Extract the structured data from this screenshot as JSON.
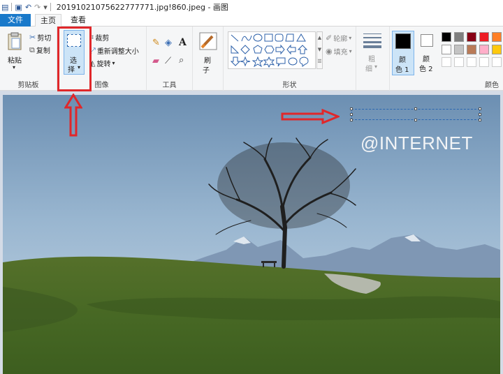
{
  "titlebar": {
    "title": "20191021075622777771.jpg!860.jpeg - 画图",
    "save_icon": "save-icon",
    "undo_icon": "undo-icon",
    "redo_icon": "redo-icon"
  },
  "tabs": {
    "file": "文件",
    "home": "主页",
    "view": "查看"
  },
  "clipboard": {
    "paste": "粘贴",
    "cut": "剪切",
    "copy": "复制",
    "label": "剪贴板"
  },
  "image": {
    "select_1": "选",
    "select_2": "择",
    "crop": "裁剪",
    "resize": "重新调整大小",
    "rotate": "旋转",
    "label": "图像"
  },
  "tools": {
    "label": "工具"
  },
  "brush": {
    "label_1": "刷",
    "label_2": "子"
  },
  "shapes": {
    "outline": "轮廓",
    "fill": "填充",
    "label": "形状"
  },
  "size": {
    "label_1": "粗",
    "label_2": "细"
  },
  "colors": {
    "color1_1": "颜",
    "color1_2": "色 1",
    "color2_1": "颜",
    "color2_2": "色 2",
    "label": "颜色",
    "palette": [
      "#000000",
      "#7f7f7f",
      "#880015",
      "#ed1c24",
      "#ff7f27",
      "#ffffff",
      "#c3c3c3",
      "#b97a57",
      "#ffaec9",
      "#ffc90e"
    ],
    "color1_value": "#000000",
    "color2_value": "#ffffff"
  },
  "canvas": {
    "watermark": "@INTERNET"
  },
  "annotations": {
    "highlight_color": "#e0272a"
  }
}
